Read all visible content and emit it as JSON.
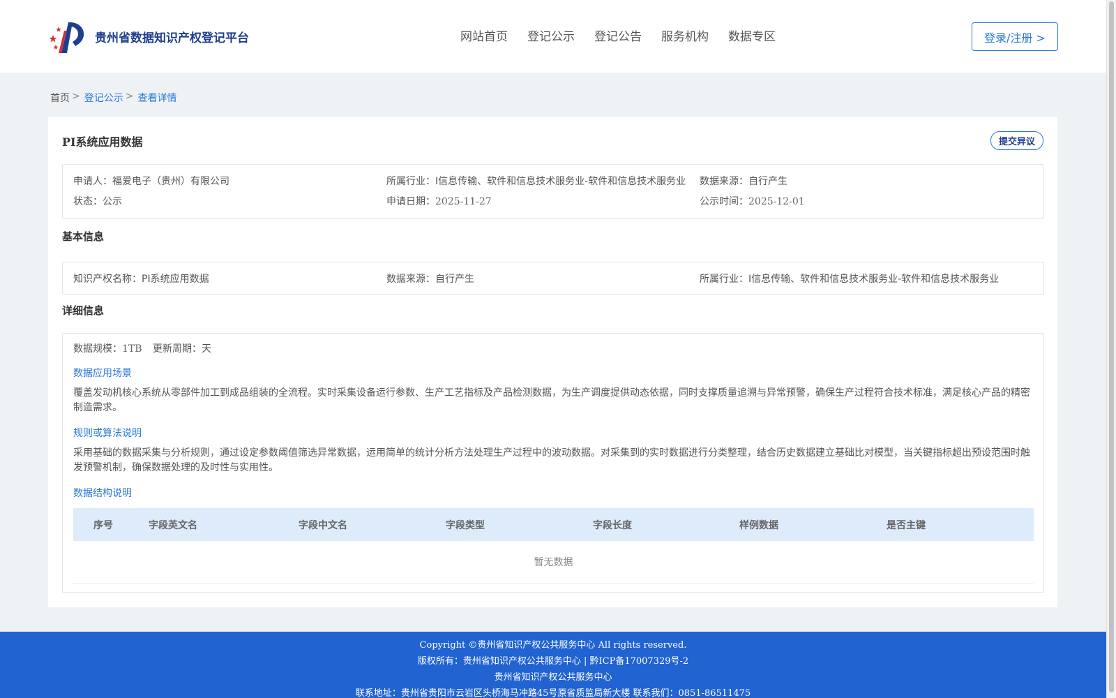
{
  "header": {
    "logo_text": "贵州省数据知识产权登记平台",
    "nav": [
      "网站首页",
      "登记公示",
      "登记公告",
      "服务机构",
      "数据专区"
    ],
    "login_label": "登录/注册 >"
  },
  "breadcrumb": {
    "home": "首页",
    "sep": ">",
    "items": [
      "登记公示",
      "查看详情"
    ]
  },
  "detail": {
    "title": "PI系统应用数据",
    "objection_label": "提交异议",
    "summary": {
      "applicant_label": "申请人：",
      "applicant": "福爱电子（贵州）有限公司",
      "industry_label": "所属行业：",
      "industry": "I信息传输、软件和信息技术服务业-软件和信息技术服务业",
      "source_label": "数据来源：",
      "source": "自行产生",
      "status_label": "状态：",
      "status": "公示",
      "apply_date_label": "申请日期：",
      "apply_date": "2025-11-27",
      "publish_label": "公示时间：",
      "publish_date": "2025-12-01"
    },
    "basic_title": "基本信息",
    "basic": {
      "ip_name_label": "知识产权名称：",
      "ip_name": "PI系统应用数据",
      "source_label": "数据来源：",
      "source": "自行产生",
      "industry_label": "所属行业：",
      "industry": "I信息传输、软件和信息技术服务业-软件和信息技术服务业"
    },
    "detail_title": "详细信息",
    "scale_label": "数据规模：",
    "scale": "1TB",
    "cycle_label": "更新周期：",
    "cycle": "天",
    "scenario_title": "数据应用场景",
    "scenario_text": "覆盖发动机核心系统从零部件加工到成品组装的全流程。实时采集设备运行参数、生产工艺指标及产品检测数据，为生产调度提供动态依据，同时支撑质量追溯与异常预警，确保生产过程符合技术标准，满足核心产品的精密制造需求。",
    "rules_title": "规则或算法说明",
    "rules_text": "采用基础的数据采集与分析规则，通过设定参数阈值筛选异常数据，运用简单的统计分析方法处理生产过程中的波动数据。对采集到的实时数据进行分类整理，结合历史数据建立基础比对模型，当关键指标超出预设范围时触发预警机制，确保数据处理的及时性与实用性。",
    "structure_title": "数据结构说明",
    "table_headers": [
      "序号",
      "字段英文名",
      "字段中文名",
      "字段类型",
      "字段长度",
      "样例数据",
      "是否主键"
    ],
    "empty_text": "暂无数据"
  },
  "footer": {
    "copyright": "Copyright ©贵州省知识产权公共服务中心 All rights reserved.",
    "owner": "版权所有：贵州省知识产权公共服务中心 | 黔ICP备17007329号-2",
    "org": "贵州省知识产权公共服务中心",
    "contact": "联系地址：贵州省贵阳市云岩区头桥海马冲路45号原省质监局新大楼 联系我们：0851-86511475"
  },
  "colors": {
    "brand": "#1e3f8e",
    "accent": "#2a78d8",
    "footer_bg": "#2163d1",
    "table_head_bg": "#deebfb"
  }
}
